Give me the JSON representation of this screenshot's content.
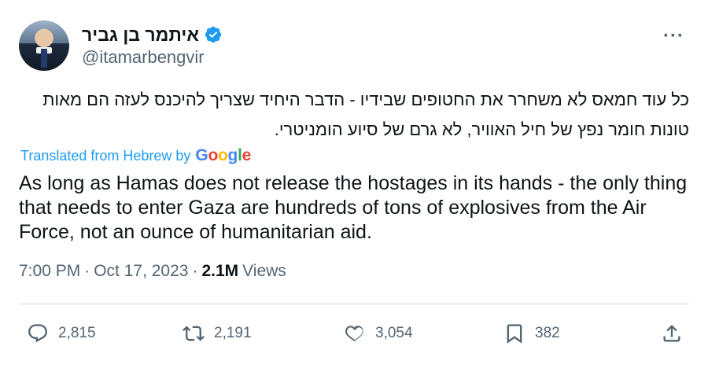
{
  "author": {
    "display_name": "איתמר בן גביר",
    "handle": "@itamarbengvir",
    "verified": true
  },
  "more_label": "···",
  "tweet": {
    "text_original": "כל עוד חמאס לא משחרר את החטופים שבידיו - הדבר היחיד שצריך להיכנס לעזה הם מאות טונות חומר נפץ של חיל האוויר, לא גרם של סיוע הומניטרי.",
    "translation_note": "Translated from Hebrew by",
    "translation_provider": [
      "G",
      "o",
      "o",
      "g",
      "l",
      "e"
    ],
    "text_translated": "As long as Hamas does not release the hostages in its hands - the only thing that needs to enter Gaza are hundreds of tons of explosives from the Air Force, not an ounce of humanitarian aid."
  },
  "meta": {
    "time": "7:00 PM",
    "separator": "·",
    "date": "Oct 17, 2023",
    "views_count": "2.1M",
    "views_label": "Views"
  },
  "actions": {
    "replies": "2,815",
    "reposts": "2,191",
    "likes": "3,054",
    "bookmarks": "382"
  },
  "colors": {
    "link_blue": "#1d9bf0",
    "muted": "#536471",
    "text": "#0f1419",
    "divider": "#cfd9de"
  }
}
